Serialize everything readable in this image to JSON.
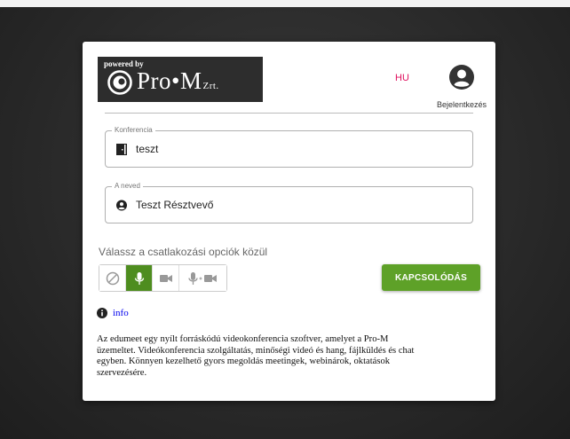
{
  "logo": {
    "powered_by": "powered by",
    "brand": "Pro•M",
    "suffix": "Zrt."
  },
  "header": {
    "language": "HU",
    "login_label": "Bejelentkezés"
  },
  "conference": {
    "label": "Konferencia",
    "value": "teszt"
  },
  "name": {
    "label": "A neved",
    "value": "Teszt Résztvevő"
  },
  "options": {
    "label": "Válassz a csatlakozási opciók közül",
    "items": [
      "none",
      "microphone",
      "camera",
      "microphone+camera"
    ],
    "selected": "microphone"
  },
  "connect_button": "KAPCSOLÓDÁS",
  "info_link": "info",
  "description_lines": [
    "Az edumeet egy nyílt forráskódú videokonferencia szoftver, amelyet a Pro-M",
    "üzemeltet. Videókonferencia szolgáltatás, minőségi videó és hang, fájlküldés és chat",
    "egyben. Könnyen kezelhető gyors megoldás meetingek, webinárok, oktatások",
    "szervezésére."
  ],
  "colors": {
    "accent_green": "#5ea128",
    "selected_green": "#4e8d1f",
    "language_red": "#e0115f",
    "link_blue": "#0000ee"
  }
}
